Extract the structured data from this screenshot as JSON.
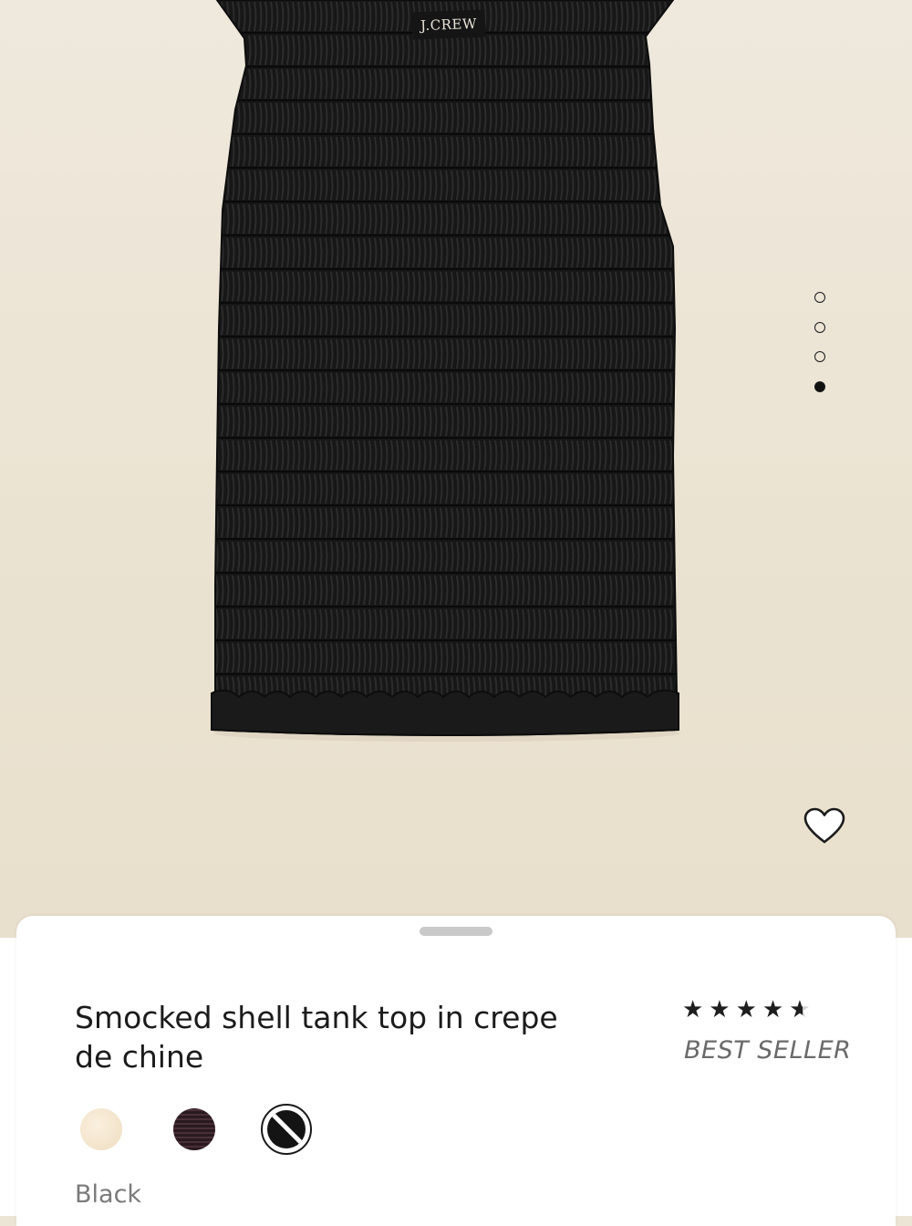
{
  "product": {
    "brand": "J.CREW",
    "title": "Smocked shell tank top in crepe de chine",
    "rating_stars": 4.5,
    "rating_display": "★★★★",
    "badge": "BEST SELLER",
    "selected_color": "Black",
    "swatches": [
      {
        "name": "Cream",
        "hex": "#f3e6d0"
      },
      {
        "name": "Plum",
        "hex": "#3a242c"
      },
      {
        "name": "Black",
        "hex": "#141414"
      }
    ]
  },
  "gallery": {
    "page_count": 4,
    "active_page": 4
  },
  "colors": {
    "background": "#ece5d6",
    "garment": "#161616",
    "sheet": "#ffffff",
    "text": "#1b1b1b",
    "muted_text": "#7a7a7a"
  }
}
